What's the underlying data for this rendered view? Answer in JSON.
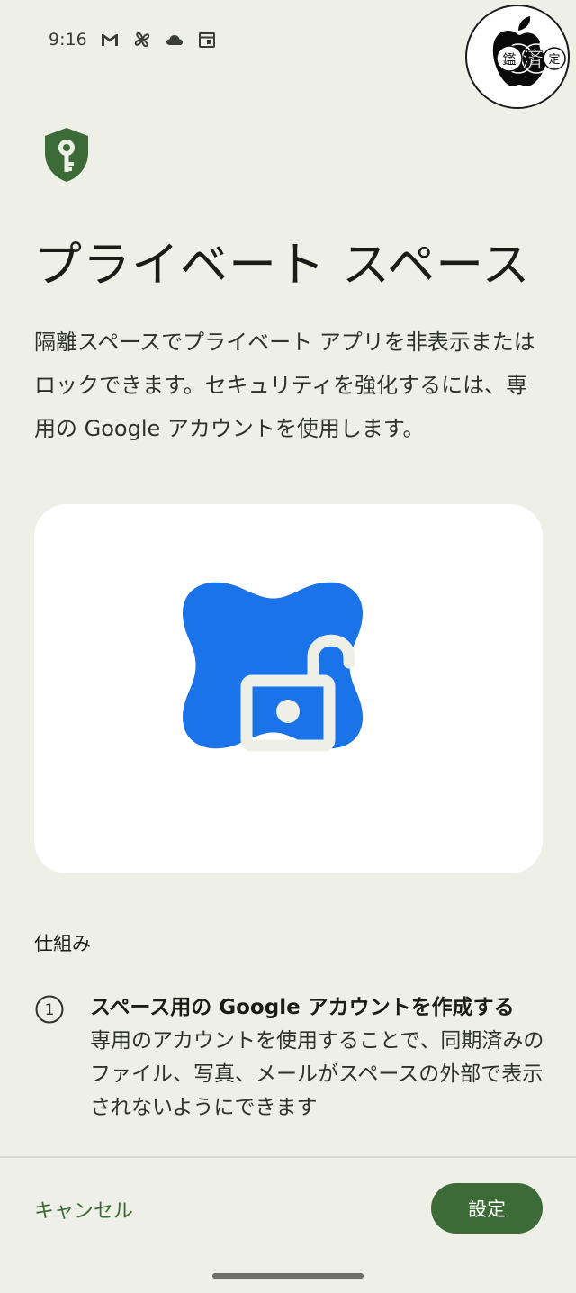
{
  "status_bar": {
    "time": "9:16",
    "icons": [
      "gmail-icon",
      "pinwheel-icon",
      "cloud-icon",
      "calendar-icon"
    ]
  },
  "watermark": {
    "text_left": "鑑",
    "text_center": "済",
    "text_right": "定"
  },
  "header": {
    "icon": "shield-key-icon",
    "title": "プライベート スペース"
  },
  "description": "隔離スペースでプライベート アプリを非表示またはロックできます。セキュリティを強化するには、専用の Google アカウントを使用します。",
  "illustration": {
    "icon": "unlocked-padlock-icon",
    "colors": {
      "blob": "#1a73e8",
      "lock": "#eef0e8"
    }
  },
  "section": {
    "label": "仕組み"
  },
  "steps": [
    {
      "number": "1",
      "title": "スペース用の Google アカウントを作成する",
      "text": "専用のアカウントを使用することで、同期済みのファイル、写真、メールがスペースの外部で表示されないようにできます"
    }
  ],
  "footer": {
    "cancel_label": "キャンセル",
    "setup_label": "設定"
  },
  "colors": {
    "background": "#eef0e8",
    "primary": "#3d6b37",
    "accent_blue": "#1a73e8"
  }
}
